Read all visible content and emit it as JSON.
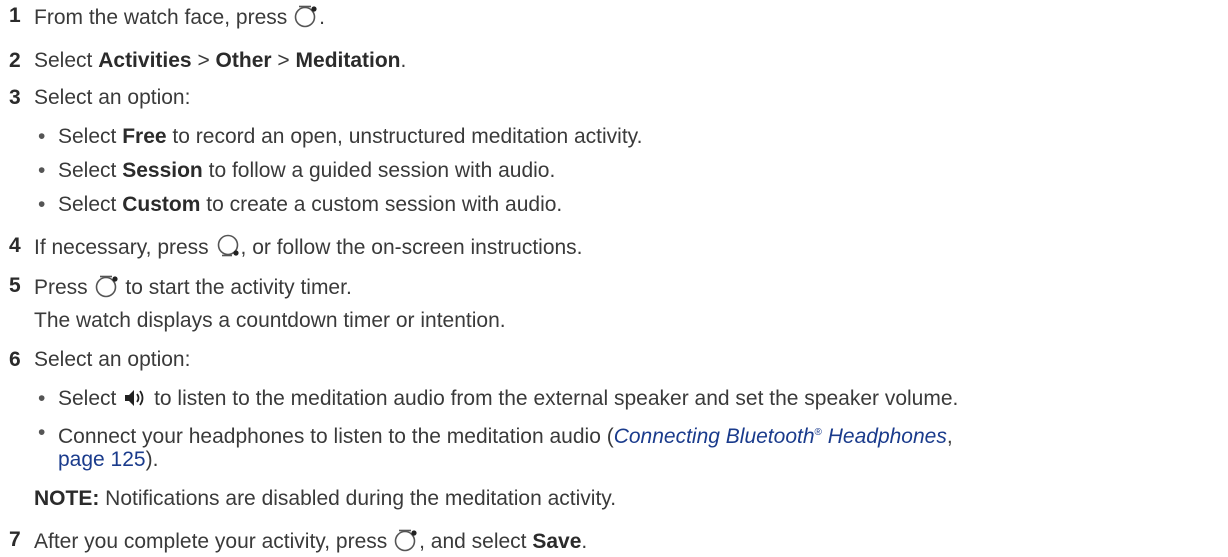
{
  "steps": {
    "s1": {
      "num": "1",
      "text": "From the watch face, press",
      "after": "."
    },
    "s2": {
      "num": "2",
      "pre": "Select",
      "a": "Activities",
      "sep": ">",
      "b": "Other",
      "c": "Meditation",
      "end": "."
    },
    "s3": {
      "num": "3",
      "text": "Select an option:"
    },
    "s3_bullets": [
      {
        "pre": "Select",
        "bold": "Free",
        "post": "to record an open, unstructured meditation activity."
      },
      {
        "pre": "Select",
        "bold": "Session",
        "post": "to follow a guided session with audio."
      },
      {
        "pre": "Select",
        "bold": "Custom",
        "post": "to create a custom session with audio."
      }
    ],
    "s4": {
      "num": "4",
      "pre": "If necessary, press",
      "post": ", or follow the on-screen instructions."
    },
    "s5": {
      "num": "5",
      "pre": "Press",
      "post": "to start the activity timer.",
      "sub": "The watch displays a countdown timer or intention."
    },
    "s6": {
      "num": "6",
      "text": "Select an option:"
    },
    "s6_b1": {
      "pre": "Select",
      "post": "to listen to the meditation audio from the external speaker and set the speaker volume."
    },
    "s6_b2": {
      "pre": "Connect your headphones to listen to the meditation audio (",
      "link": "Connecting Bluetooth",
      "reg": "®",
      "link2": "Headphones",
      "comma": ",",
      "page": "page 125",
      "end": ")."
    },
    "note": {
      "label": "NOTE:",
      "text": "Notifications are disabled during the meditation activity."
    },
    "s7": {
      "num": "7",
      "pre": "After you complete your activity, press",
      "mid": ", and select",
      "bold": "Save",
      "end": "."
    }
  },
  "icons": {
    "start_button": "watch-start-button-icon",
    "back_button": "watch-back-button-icon",
    "speaker": "speaker-icon"
  },
  "colors": {
    "text": "#3a3a3a",
    "link": "#1a3b8c"
  }
}
